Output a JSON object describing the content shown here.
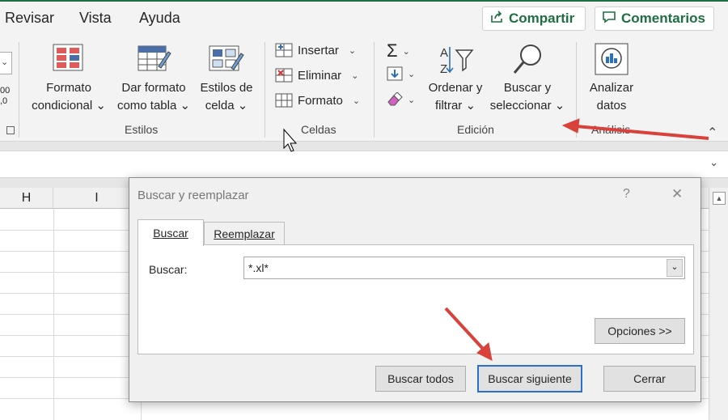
{
  "tabs": {
    "revisar": "Revisar",
    "vista": "Vista",
    "ayuda": "Ayuda"
  },
  "top_buttons": {
    "compartir": "Compartir",
    "comentarios": "Comentarios"
  },
  "ribbon": {
    "partial_text": "00\n,0",
    "styles": {
      "formato_condicional": [
        "Formato",
        "condicional ⌄"
      ],
      "dar_formato": [
        "Dar formato",
        "como tabla ⌄"
      ],
      "estilos_celda": [
        "Estilos de",
        "celda ⌄"
      ],
      "group": "Estilos"
    },
    "cells": {
      "insertar": "Insertar",
      "eliminar": "Eliminar",
      "formato": "Formato",
      "group": "Celdas"
    },
    "edit": {
      "ordenar": [
        "Ordenar y",
        "filtrar ⌄"
      ],
      "buscar": [
        "Buscar y",
        "seleccionar ⌄"
      ],
      "group": "Edición"
    },
    "analysis": {
      "analizar": [
        "Analizar",
        "datos"
      ],
      "group": "Análisis"
    }
  },
  "sheet": {
    "columns": [
      "H",
      "I"
    ]
  },
  "dialog": {
    "title": "Buscar y reemplazar",
    "help": "?",
    "close": "✕",
    "tabs": [
      "Buscar",
      "Reemplazar"
    ],
    "field_label": "Buscar:",
    "field_value": "*.xl*",
    "options_button": "Opciones >>",
    "buttons": [
      "Buscar todos",
      "Buscar siguiente",
      "Cerrar"
    ]
  },
  "colors": {
    "accent_green": "#1e6e42",
    "arrow_red": "#d9413b"
  }
}
